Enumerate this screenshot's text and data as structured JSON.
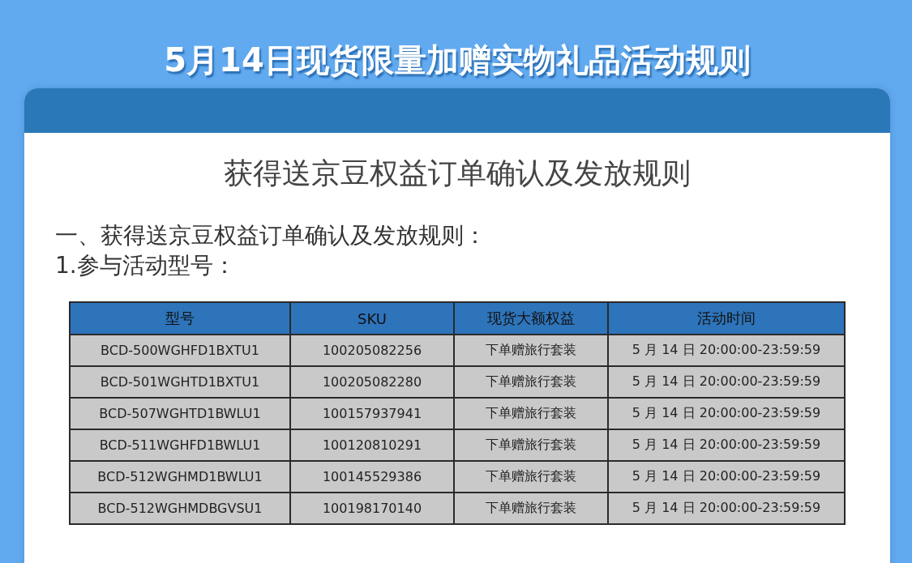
{
  "page_title": "5月14日现货限量加赠实物礼品活动规则",
  "card": {
    "heading": "获得送京豆权益订单确认及发放规则",
    "paragraphs": [
      "一、获得送京豆权益订单确认及发放规则：",
      "1.参与活动型号："
    ],
    "table": {
      "columns": [
        "型号",
        "SKU",
        "现货大额权益",
        "活动时间"
      ],
      "rows": [
        [
          "BCD-500WGHFD1BXTU1",
          "100205082256",
          "下单赠旅行套装",
          "5 月 14 日  20:00:00-23:59:59"
        ],
        [
          "BCD-501WGHTD1BXTU1",
          "100205082280",
          "下单赠旅行套装",
          "5 月 14 日  20:00:00-23:59:59"
        ],
        [
          "BCD-507WGHTD1BWLU1",
          "100157937941",
          "下单赠旅行套装",
          "5 月 14 日  20:00:00-23:59:59"
        ],
        [
          "BCD-511WGHFD1BWLU1",
          "100120810291",
          "下单赠旅行套装",
          "5 月 14 日  20:00:00-23:59:59"
        ],
        [
          "BCD-512WGHMD1BWLU1",
          "100145529386",
          "下单赠旅行套装",
          "5 月 14 日  20:00:00-23:59:59"
        ],
        [
          "BCD-512WGHMDBGVSU1",
          "100198170140",
          "下单赠旅行套装",
          "5 月 14 日  20:00:00-23:59:59"
        ]
      ]
    }
  }
}
